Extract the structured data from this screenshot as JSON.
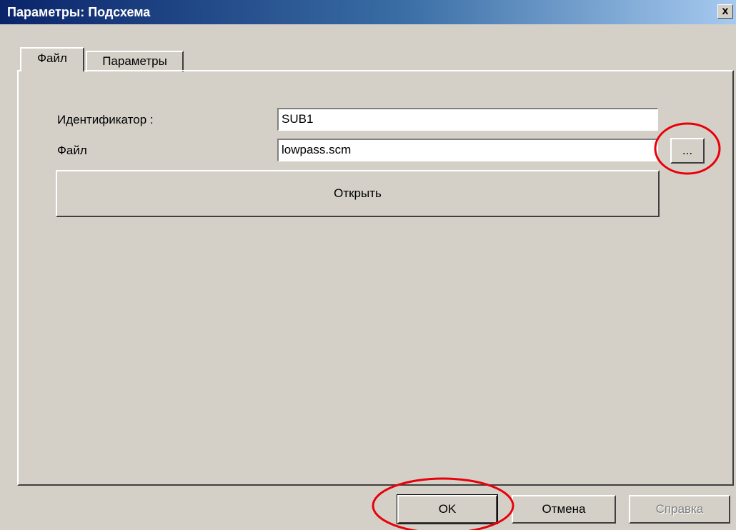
{
  "window": {
    "title": "Параметры: Подсхема",
    "close_glyph": "x"
  },
  "tabs": [
    {
      "label": "Файл",
      "active": true
    },
    {
      "label": "Параметры",
      "active": false
    }
  ],
  "form": {
    "identifier_label": "Идентификатор :",
    "identifier_value": "SUB1",
    "file_label": "Файл",
    "file_value": "lowpass.scm",
    "browse_label": "...",
    "open_label": "Открыть"
  },
  "buttons": {
    "ok_label": "OK",
    "cancel_label": "Отмена",
    "help_label": "Справка"
  },
  "annotation_color": "#e8000a"
}
